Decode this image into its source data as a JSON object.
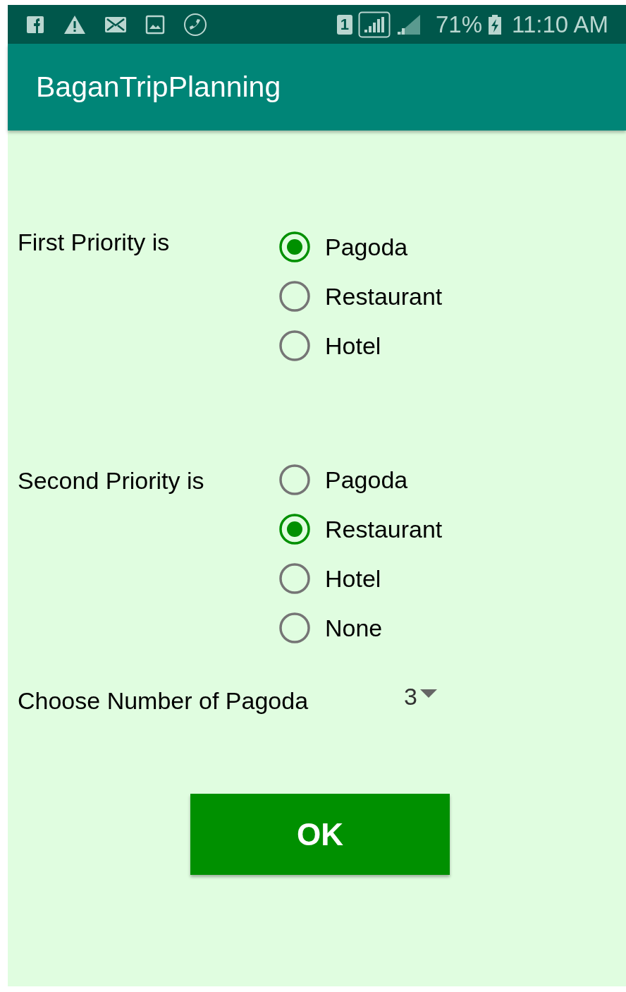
{
  "status_bar": {
    "sim": "1",
    "battery": "71%",
    "time": "11:10 AM"
  },
  "app_bar": {
    "title": "BaganTripPlanning"
  },
  "groups": [
    {
      "label": "First Priority is",
      "options": [
        {
          "label": "Pagoda",
          "selected": true
        },
        {
          "label": "Restaurant",
          "selected": false
        },
        {
          "label": "Hotel",
          "selected": false
        }
      ]
    },
    {
      "label": "Second Priority is",
      "options": [
        {
          "label": "Pagoda",
          "selected": false
        },
        {
          "label": "Restaurant",
          "selected": true
        },
        {
          "label": "Hotel",
          "selected": false
        },
        {
          "label": "None",
          "selected": false
        }
      ]
    }
  ],
  "spinner": {
    "label": "Choose Number of Pagoda",
    "value": "3"
  },
  "button": "OK"
}
